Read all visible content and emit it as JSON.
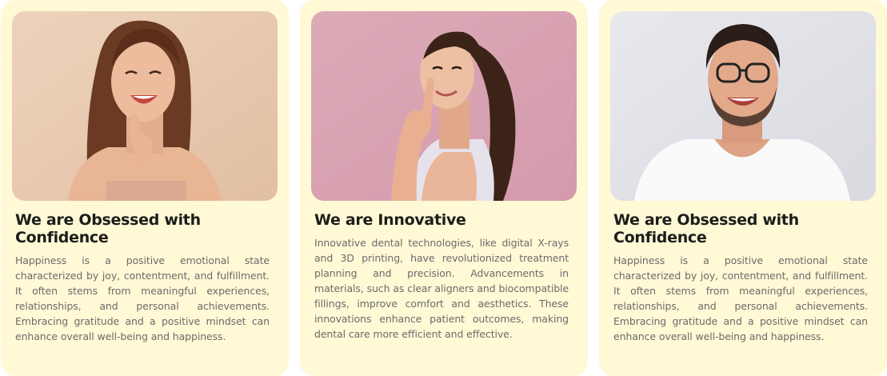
{
  "cards": [
    {
      "title": "We are Obsessed with Confidence",
      "body": "Happiness is a positive emotional state characterized by joy, contentment, and fulfillment. It often stems from meaningful experiences, relationships, and personal achievements. Embracing gratitude and a positive mindset can enhance overall well-being and happiness.",
      "photo_bg": "#E9C9AE"
    },
    {
      "title": "We are Innovative",
      "body": "Innovative dental technologies, like digital X-rays and 3D printing, have revolutionized treatment planning and precision. Advancements in materials, such as clear aligners and biocompatible fillings, improve comfort and aesthetics. These innovations enhance patient outcomes, making dental care more efficient and effective.",
      "photo_bg": "#D9A3B2"
    },
    {
      "title": "We are Obsessed with Confidence",
      "body": "Happiness is a positive emotional state characterized by joy, contentment, and fulfillment. It often stems from meaningful experiences, relationships, and personal achievements. Embracing gratitude and a positive mindset can enhance overall well-being and happiness.",
      "photo_bg": "#E4E5EA"
    }
  ],
  "theme": {
    "card_bg": "#FFF9D6",
    "title_color": "#1d1d1b",
    "body_color": "#6b6b6b"
  }
}
